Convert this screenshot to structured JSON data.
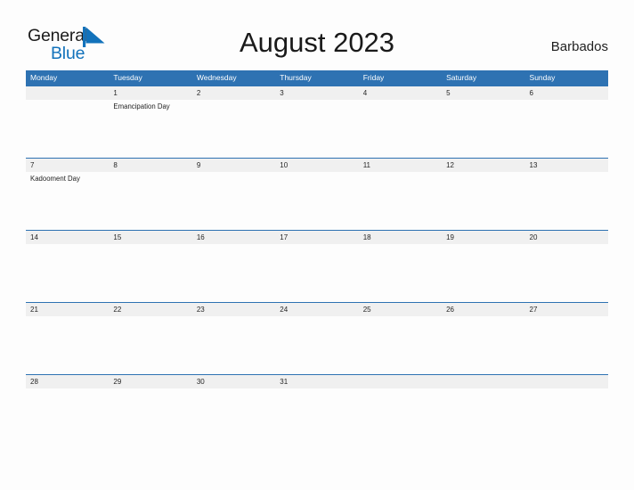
{
  "brand": {
    "name_part1": "General",
    "name_part2": "Blue",
    "flag_icon": "blue-triangle-flag-icon",
    "accent_color": "#1272bb"
  },
  "header": {
    "title": "August 2023",
    "country": "Barbados"
  },
  "calendar": {
    "header_bg_color": "#2e72b2",
    "date_band_color": "#f0f0f0",
    "weekday_headers": [
      "Monday",
      "Tuesday",
      "Wednesday",
      "Thursday",
      "Friday",
      "Saturday",
      "Sunday"
    ],
    "weeks": [
      {
        "dates": [
          "",
          "1",
          "2",
          "3",
          "4",
          "5",
          "6"
        ],
        "events": [
          "",
          "Emancipation Day",
          "",
          "",
          "",
          "",
          ""
        ]
      },
      {
        "dates": [
          "7",
          "8",
          "9",
          "10",
          "11",
          "12",
          "13"
        ],
        "events": [
          "Kadooment Day",
          "",
          "",
          "",
          "",
          "",
          ""
        ]
      },
      {
        "dates": [
          "14",
          "15",
          "16",
          "17",
          "18",
          "19",
          "20"
        ],
        "events": [
          "",
          "",
          "",
          "",
          "",
          "",
          ""
        ]
      },
      {
        "dates": [
          "21",
          "22",
          "23",
          "24",
          "25",
          "26",
          "27"
        ],
        "events": [
          "",
          "",
          "",
          "",
          "",
          "",
          ""
        ]
      },
      {
        "dates": [
          "28",
          "29",
          "30",
          "31",
          "",
          "",
          ""
        ],
        "events": [
          "",
          "",
          "",
          "",
          "",
          "",
          ""
        ]
      }
    ]
  }
}
